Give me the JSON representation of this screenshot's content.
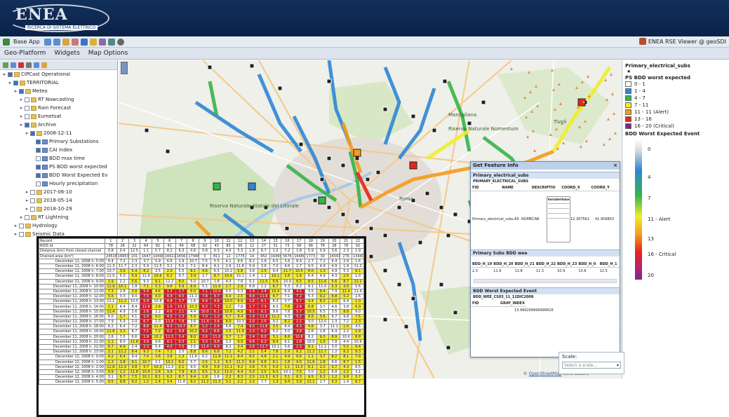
{
  "header": {
    "logo_text": "ENEA",
    "logo_sub": "RICERCA DI SISTEMA ELETTRICO"
  },
  "toolbar": {
    "base_app": "Base App",
    "right_title": "ENEA RSE Viewer @ geoSDI"
  },
  "menu": {
    "items": [
      "Geo-Platform",
      "Widgets",
      "Map Options"
    ]
  },
  "tree": {
    "nodes": [
      {
        "label": "CIPCast Operational",
        "depth": 0,
        "type": "folder",
        "checked": true
      },
      {
        "label": "TERRITORIAL",
        "depth": 1,
        "type": "folder",
        "checked": true
      },
      {
        "label": "Meteo",
        "depth": 2,
        "type": "folder",
        "checked": true
      },
      {
        "label": "RT Nowcasting",
        "depth": 3,
        "type": "folder",
        "checked": false
      },
      {
        "label": "Rain Forecast",
        "depth": 3,
        "type": "folder",
        "checked": false
      },
      {
        "label": "Eumetsat",
        "depth": 3,
        "type": "folder",
        "checked": false
      },
      {
        "label": "Archive",
        "depth": 3,
        "type": "folder",
        "checked": true
      },
      {
        "label": "2008-12-11",
        "depth": 4,
        "type": "folder",
        "checked": true
      },
      {
        "label": "Primary Substations",
        "depth": 5,
        "type": "layer",
        "checked": true
      },
      {
        "label": "CAI Index",
        "depth": 5,
        "type": "layer",
        "checked": true
      },
      {
        "label": "BDD max time",
        "depth": 5,
        "type": "layer",
        "checked": false
      },
      {
        "label": "PS BDD worst expected",
        "depth": 5,
        "type": "layer",
        "checked": true
      },
      {
        "label": "BDD Worst Expected Ev",
        "depth": 5,
        "type": "layer",
        "checked": true
      },
      {
        "label": "Hourly precipitation",
        "depth": 5,
        "type": "layer",
        "checked": false
      },
      {
        "label": "2017-06-10",
        "depth": 4,
        "type": "folder",
        "checked": false
      },
      {
        "label": "2018-05-14",
        "depth": 4,
        "type": "folder",
        "checked": false
      },
      {
        "label": "2018-10-29",
        "depth": 4,
        "type": "folder",
        "checked": false
      },
      {
        "label": "RT Lightning",
        "depth": 3,
        "type": "folder",
        "checked": false
      },
      {
        "label": "Hydrology",
        "depth": 2,
        "type": "folder",
        "checked": false
      },
      {
        "label": "Seismic Data",
        "depth": 2,
        "type": "folder",
        "checked": false
      }
    ]
  },
  "map": {
    "place_labels": [
      "Riserva Naturale Statale del Litorale",
      "Roma",
      "Riserva Naturale Nomentum",
      "Marcigliana",
      "Tivoli"
    ],
    "credit_prefix": "© ",
    "credit_link": "OpenStreetMap",
    "credit_suffix": " contributors"
  },
  "legend": {
    "title": "Primary_electrical_subs",
    "section1": "PS BDD worst expected",
    "items": [
      {
        "label": "0 - 1",
        "color": "#ffffff"
      },
      {
        "label": "1 - 4",
        "color": "#2d86d6"
      },
      {
        "label": "4 - 7",
        "color": "#36b34a"
      },
      {
        "label": "7 - 11",
        "color": "#f2ec2a"
      },
      {
        "label": "11 - 11 (Alert)",
        "color": "#f59a1d"
      },
      {
        "label": "13 - 16",
        "color": "#e5261b"
      },
      {
        "label": "16 - 20 (Critical)",
        "color": "#7a2890"
      }
    ],
    "section2": "BDD Worst Expected Event",
    "gradient_labels": [
      "0",
      "4",
      "7",
      "11 - Alert",
      "13",
      "16 - Critical",
      "20"
    ]
  },
  "gfi": {
    "title": "Get Feature Info",
    "sec1": "Primary_electrical_subs",
    "sec1_sub": "PRIMARY_ELECTRICAL_SUBS",
    "sec1_cols": [
      "FID",
      "NAME",
      "DESCRIPTIO",
      "COORD_X",
      "COORD_Y"
    ],
    "sec1_vals": [
      "Primary_electrical_subs.60",
      "NOMECAB",
      "",
      "12.307561",
      "41.956803"
    ],
    "inner_head": [
      "Variable",
      "Value"
    ],
    "sec2": "Primary Subs BDD wee",
    "sec2_cols": [
      "BDD_H_19",
      "BDD_H_20",
      "BDD_H_21",
      "BDD_H_22",
      "BDD_H_23",
      "BDD_H_0",
      "BDD_H_1"
    ],
    "sec2_vals": [
      "2.3",
      "11.9",
      "11.8",
      "11.3",
      "10.9",
      "10.8",
      "12.5"
    ],
    "sec3": "BDD Worst Expected Event",
    "sec3_sub": "BDD_WEE_CS03_11_12DIC2008",
    "sec3_cols": [
      "FID",
      "GRAY_INDEX"
    ],
    "sec3_vals": [
      "",
      "13.990209999990616"
    ],
    "scale_label": "Scale:",
    "scale_placeholder": "Select a scale..."
  },
  "table": {
    "head_labels": [
      "Record",
      "ROIS Id",
      "Distance (km) from closed channel",
      "Drained area (km²)"
    ],
    "cols": [
      "1",
      "2",
      "3",
      "4",
      "5",
      "6",
      "7",
      "8",
      "9",
      "10",
      "11",
      "12",
      "13",
      "14",
      "15",
      "16",
      "17",
      "18",
      "19",
      "20",
      "21",
      "22"
    ],
    "row_ids": [
      "78",
      "26",
      "22",
      "64",
      "82",
      "41",
      "49",
      "68",
      "62",
      "43",
      "85",
      "56",
      "12",
      "27",
      "31",
      "73",
      "58",
      "66",
      "78",
      "28",
      "78",
      "92"
    ],
    "row_dist": [
      "0.8",
      "0.4",
      "12.5",
      "1.1",
      "5.7",
      "8.2",
      "6.3",
      "0.6",
      "0.8",
      "0.3",
      "4.0",
      "5.3",
      "1.8",
      "6.7",
      "1.0",
      "7.2",
      "1.8",
      "5.9",
      "0.9",
      "3.6",
      "2.3",
      "1.9"
    ],
    "row_area": [
      "24516",
      "16953",
      "101",
      "1647",
      "10490",
      "16611",
      "16563",
      "17946",
      "0",
      "811",
      "12",
      "1776",
      "14",
      "952",
      "16499",
      "5676",
      "16480",
      "1773",
      "30",
      "16561",
      "276",
      "13440"
    ],
    "dates": [
      "December 11, 2008 h: 5:00",
      "December 11, 2008 h: 6:00",
      "December 11, 2008 h: 7:00",
      "December 11, 2008 h: 8:00",
      "December 11, 2008 h: 9:00",
      "December 11, 2008 h: 10:00",
      "December 11, 2008 h: 11:00",
      "December 11, 2008 h: 12:00",
      "December 11, 2008 h: 13:00",
      "December 11, 2008 h: 14:00",
      "December 11, 2008 h: 15:00",
      "December 11, 2008 h: 16:00",
      "December 11, 2008 h: 17:00",
      "December 11, 2008 h: 18:00",
      "December 11, 2008 h: 19:00",
      "December 11, 2008 h: 20:00",
      "December 11, 2008 h: 21:00",
      "December 11, 2008 h: 22:00",
      "December 11, 2008 h: 23:00",
      "December 12, 2008 h: 0:00",
      "December 12, 2008 h: 1:00",
      "December 12, 2008 h: 2:00",
      "December 12, 2008 h: 3:00",
      "December 12, 2008 h: 4:00",
      "December 12, 2008 h: 5:00"
    ]
  }
}
